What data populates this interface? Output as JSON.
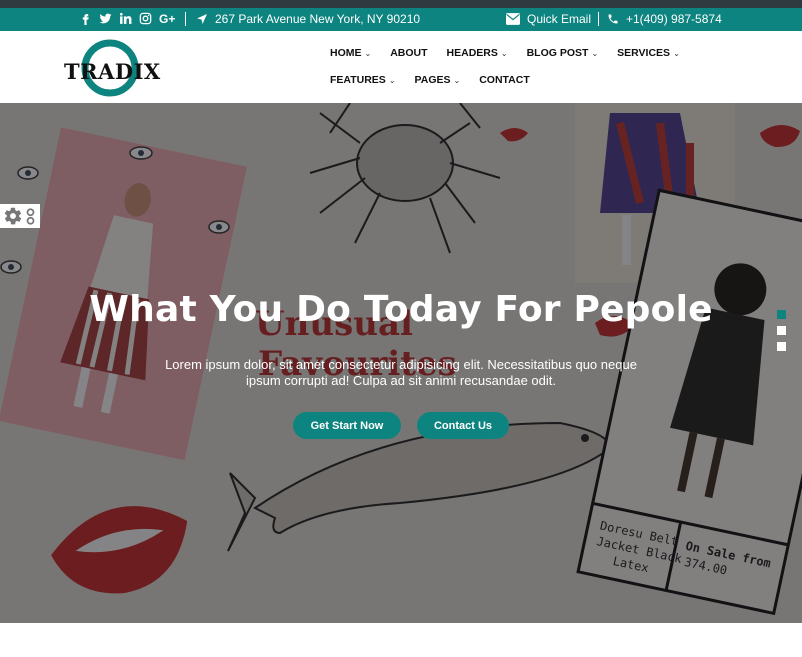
{
  "topbar": {
    "social_icons": [
      "facebook-icon",
      "twitter-icon",
      "linkedin-icon",
      "instagram-icon",
      "google-plus-icon"
    ],
    "google_plus_label": "G+",
    "address": "267 Park Avenue New York, NY 90210",
    "email_label": "Quick Email",
    "phone": "+1(409) 987-5874"
  },
  "logo": {
    "text": "TRADIX"
  },
  "nav": {
    "row1": [
      {
        "label": "HOME",
        "dropdown": true
      },
      {
        "label": "ABOUT",
        "dropdown": false
      },
      {
        "label": "HEADERS",
        "dropdown": true
      },
      {
        "label": "BLOG POST",
        "dropdown": true
      },
      {
        "label": "SERVICES",
        "dropdown": true
      }
    ],
    "row2": [
      {
        "label": "FEATURES",
        "dropdown": true
      },
      {
        "label": "PAGES",
        "dropdown": true
      },
      {
        "label": "CONTACT",
        "dropdown": false
      }
    ]
  },
  "hero": {
    "title": "What You Do Today For Pepole",
    "subtitle": "Lorem ipsum dolor, sit amet consectetur adipisicing elit. Necessitatibus quo neque ipsum corrupti ad! Culpa ad sit animi recusandae odit.",
    "primary_button": "Get Start Now",
    "secondary_button": "Contact Us",
    "slide_count": 3,
    "active_slide": 1,
    "background_text": [
      "Unusual",
      "Favourites",
      "Doresu Belt",
      "Jacket Black",
      "Latex",
      "On Sale from",
      "374.00"
    ]
  },
  "colors": {
    "accent": "#0e8480",
    "overlay": "rgba(20,20,24,0.5)"
  }
}
